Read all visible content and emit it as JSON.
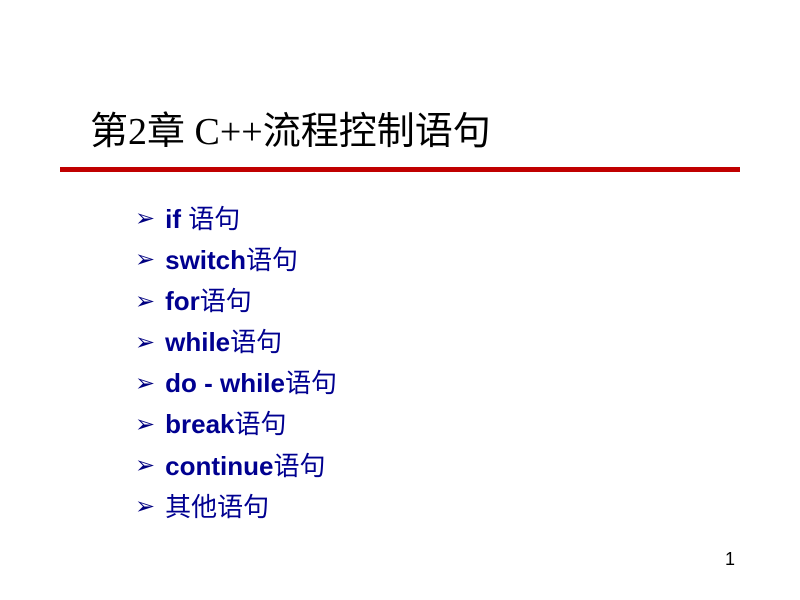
{
  "title": "第2章  C++流程控制语句",
  "bullets": [
    {
      "keyword": "if ",
      "suffix": "语句"
    },
    {
      "keyword": "switch",
      "suffix": "语句"
    },
    {
      "keyword": "for",
      "suffix": "语句"
    },
    {
      "keyword": "while",
      "suffix": "语句"
    },
    {
      "keyword": "do - while",
      "suffix": "语句"
    },
    {
      "keyword": "break",
      "suffix": "语句"
    },
    {
      "keyword": "continue",
      "suffix": "语句"
    },
    {
      "keyword": "",
      "suffix": "其他语句"
    }
  ],
  "page_number": "1",
  "bullet_glyph": "➢"
}
